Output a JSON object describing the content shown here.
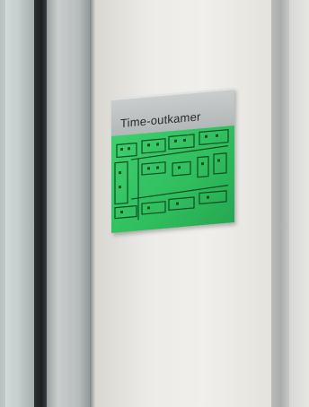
{
  "sign": {
    "title": "Time-outkamer"
  },
  "colors": {
    "sign_header": "#b8bcbc",
    "floor_plan_background": "#33c463",
    "floor_plan_lines": "#0f4d22",
    "wall": "#ecebe7",
    "window_frame": "#1f2324"
  }
}
